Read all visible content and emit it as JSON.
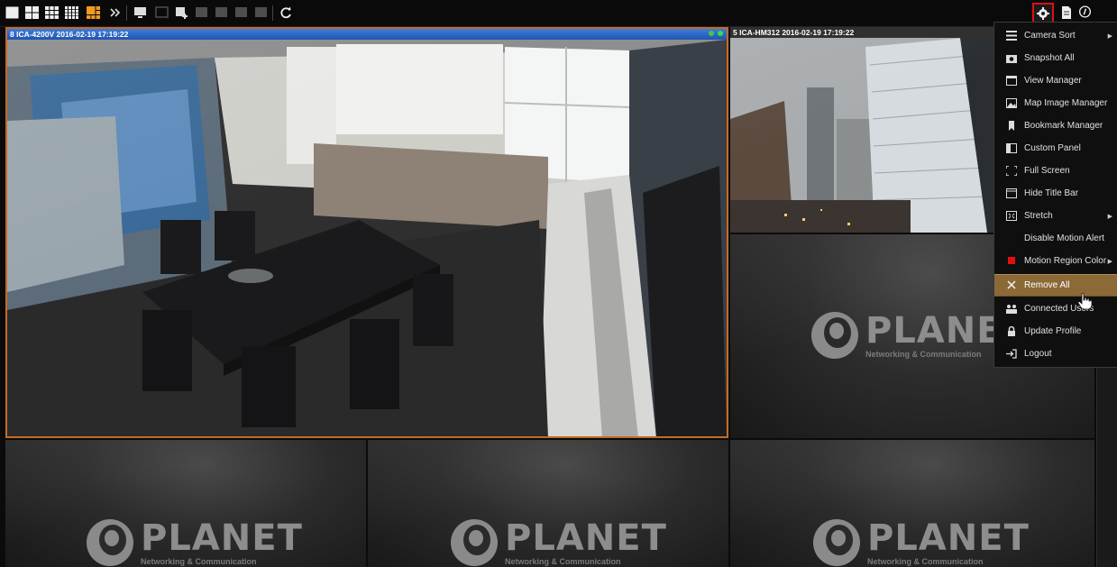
{
  "toolbar": {
    "buttons": [
      "layout-1x1",
      "layout-2x2",
      "layout-3x3",
      "layout-4x4",
      "layout-1plus5",
      "more",
      "monitor",
      "disabled-1",
      "add-view",
      "disabled-2",
      "disabled-3",
      "disabled-4",
      "disabled-5",
      "refresh"
    ],
    "right_icons": [
      "settings-icon",
      "document-icon",
      "info-icon"
    ]
  },
  "cameras": [
    {
      "title": "8 ICA-4200V  2016-02-19 17:19:22",
      "selected": true
    },
    {
      "title": "5 ICA-HM312  2016-02-19 17:19:22",
      "selected": false
    }
  ],
  "logo": {
    "name": "PLANET",
    "tagline": "Networking & Communication"
  },
  "menu": {
    "items": [
      {
        "label": "Camera Sort",
        "icon": "list-icon",
        "submenu": true
      },
      {
        "label": "Snapshot All",
        "icon": "camera-icon",
        "submenu": false
      },
      {
        "label": "View Manager",
        "icon": "window-icon",
        "submenu": false
      },
      {
        "label": "Map Image Manager",
        "icon": "image-icon",
        "submenu": false
      },
      {
        "label": "Bookmark Manager",
        "icon": "bookmark-icon",
        "submenu": false
      },
      {
        "label": "Custom Panel",
        "icon": "panel-icon",
        "submenu": false
      },
      {
        "label": "Full Screen",
        "icon": "fullscreen-icon",
        "submenu": false
      },
      {
        "label": "Hide Title Bar",
        "icon": "titlebar-icon",
        "submenu": false
      },
      {
        "label": "Stretch",
        "icon": "stretch-icon",
        "submenu": true
      },
      {
        "label": "Disable Motion Alert",
        "icon": "",
        "submenu": false
      },
      {
        "label": "Motion Region Color",
        "icon": "color-square-icon",
        "submenu": true
      },
      {
        "label": "Remove All",
        "icon": "close-icon",
        "submenu": false,
        "highlighted": true
      },
      {
        "label": "Connected Users",
        "icon": "users-icon",
        "submenu": false
      },
      {
        "label": "Update Profile",
        "icon": "lock-icon",
        "submenu": false
      },
      {
        "label": "Logout",
        "icon": "logout-icon",
        "submenu": false
      }
    ],
    "highlight_color": "#8c6a38",
    "motion_color": "#e01010"
  },
  "colors": {
    "active_title": "#2a66c8",
    "selected_border": "#c86a22",
    "settings_highlight": "#dd1111"
  }
}
